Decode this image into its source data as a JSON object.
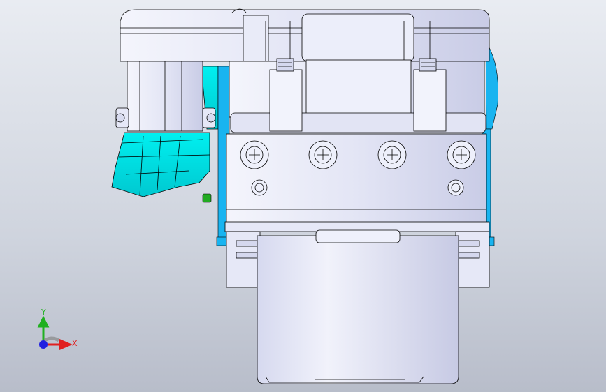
{
  "window": {
    "background_top": "#e9ecf2",
    "background_bottom": "#b8bdca"
  },
  "model": {
    "body_color": "#e6e8f7",
    "outline_color": "#000000",
    "accent_cyan": "#00e6e6",
    "accent_blue": "#19b4f0",
    "accent_green": "#22aa22"
  },
  "triad": {
    "x_label": "X",
    "y_label": "Y",
    "x_color": "#e02020",
    "y_color": "#20b020",
    "z_color": "#2020e0"
  }
}
